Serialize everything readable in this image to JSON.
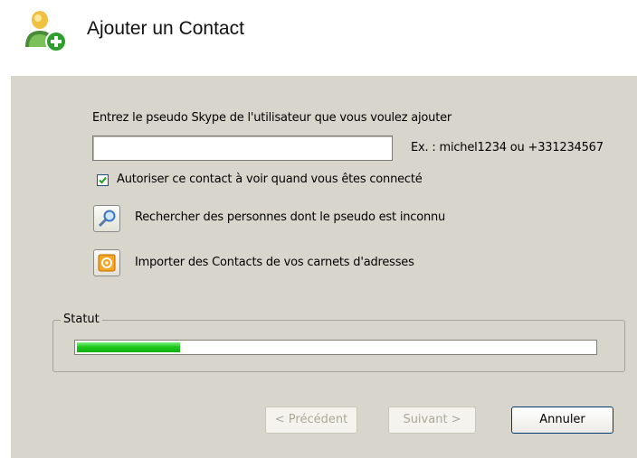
{
  "header": {
    "title": "Ajouter un Contact",
    "icon": "add-contact-icon"
  },
  "form": {
    "instruction": "Entrez le pseudo Skype de l'utilisateur que vous voulez ajouter",
    "pseudo_value": "",
    "example": "Ex. : michel1234 ou +331234567",
    "authorize_label": "Autoriser ce contact à voir quand vous êtes connecté",
    "authorize_checked": true,
    "search_label": "Rechercher des personnes dont le pseudo est inconnu",
    "search_icon": "magnifier-icon",
    "import_label": "Importer des Contacts de vos carnets d'adresses",
    "import_icon": "address-book-icon"
  },
  "status": {
    "label": "Statut",
    "progress": 0.2
  },
  "buttons": {
    "prev": "< Précédent",
    "next": "Suivant >",
    "cancel": "Annuler"
  },
  "colors": {
    "panel": "#d8d6cc",
    "progress": "#1fc91f"
  }
}
